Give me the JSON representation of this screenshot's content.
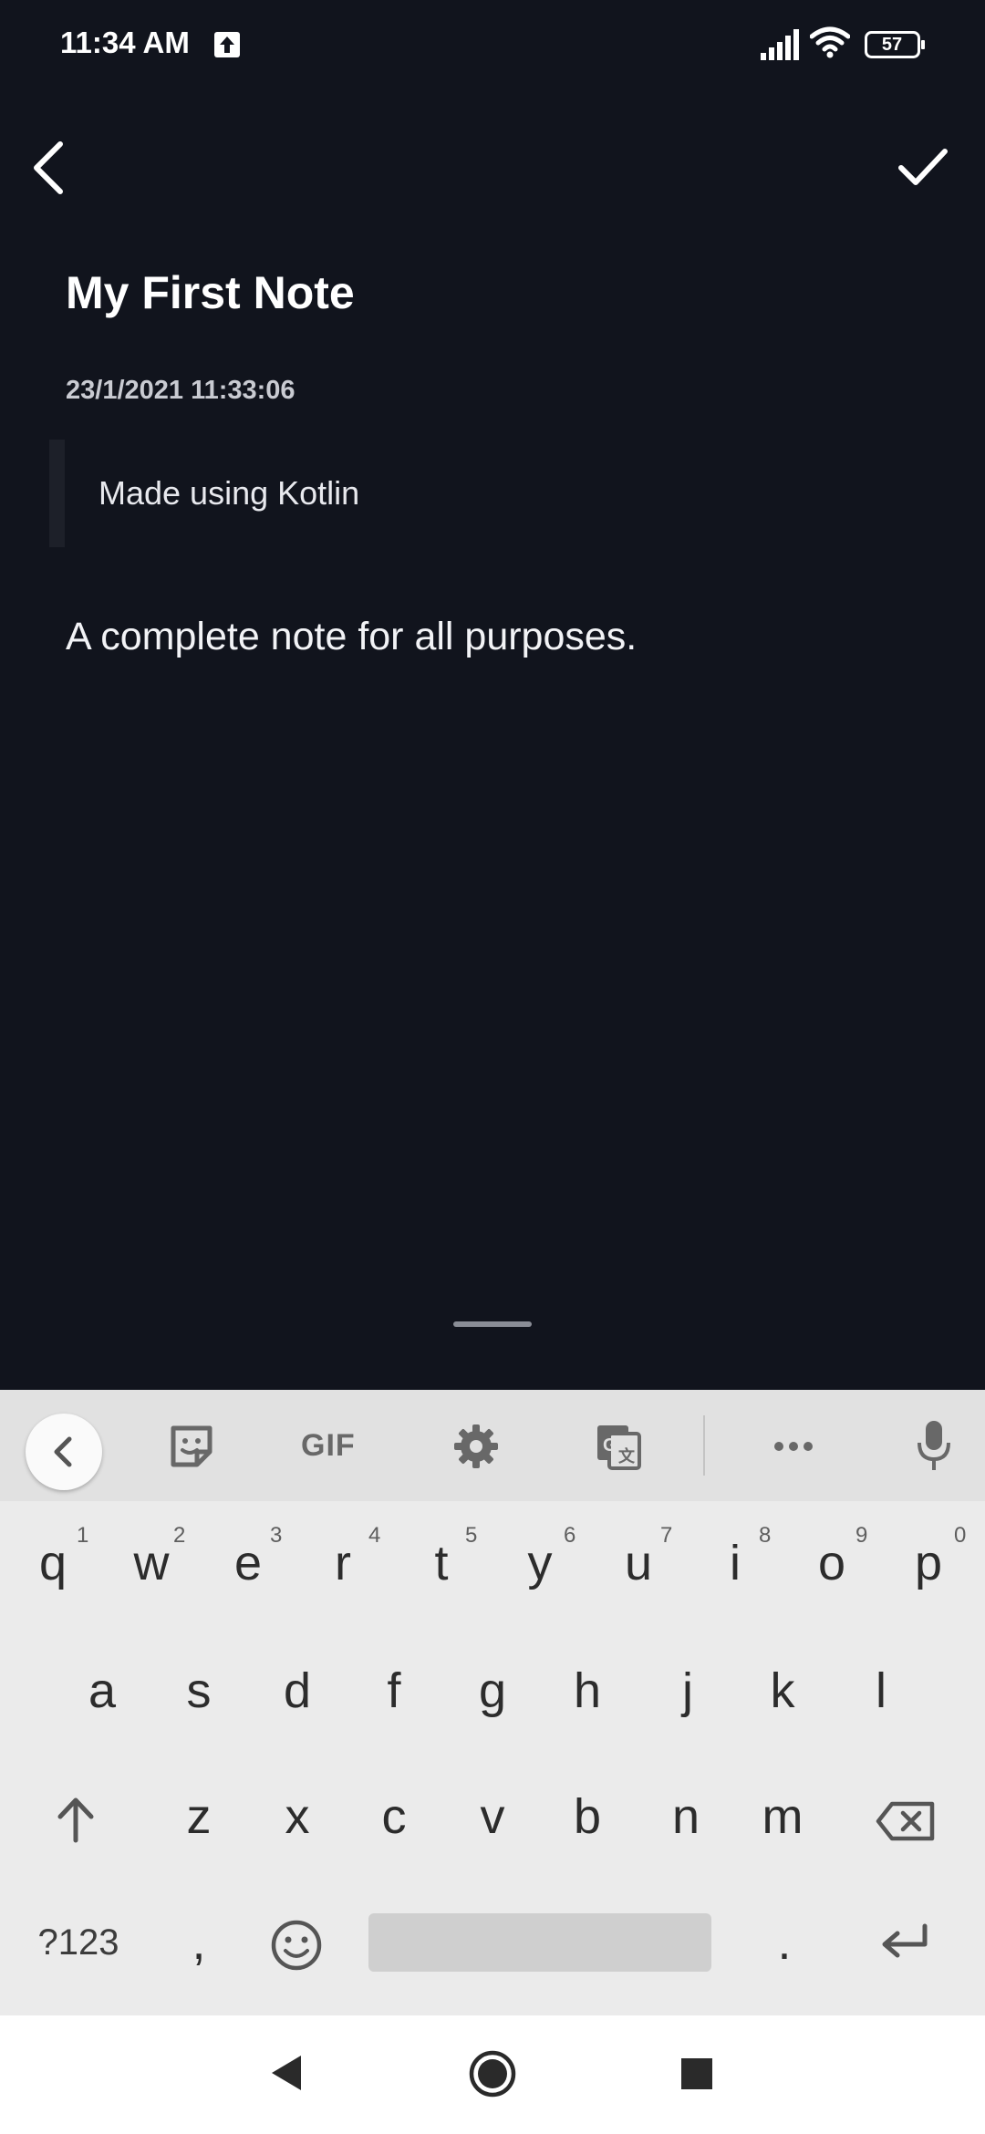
{
  "status_bar": {
    "time": "11:34 AM",
    "battery": "57",
    "icons": [
      "upload-icon",
      "signal-icon",
      "wifi-icon",
      "battery-icon"
    ]
  },
  "toolbar": {
    "back_icon": "chevron-left",
    "save_icon": "checkmark"
  },
  "note": {
    "title": "My First Note",
    "datetime": "23/1/2021 11:33:06",
    "subtitle": "Made using Kotlin",
    "body": "A complete note for all purposes."
  },
  "keyboard": {
    "toolbar": {
      "gif_label": "GIF",
      "icons": [
        "collapse-icon",
        "sticker-icon",
        "gif",
        "settings-icon",
        "translate-icon",
        "more-icon",
        "mic-icon"
      ]
    },
    "row1": [
      {
        "key": "q",
        "hint": "1"
      },
      {
        "key": "w",
        "hint": "2"
      },
      {
        "key": "e",
        "hint": "3"
      },
      {
        "key": "r",
        "hint": "4"
      },
      {
        "key": "t",
        "hint": "5"
      },
      {
        "key": "y",
        "hint": "6"
      },
      {
        "key": "u",
        "hint": "7"
      },
      {
        "key": "i",
        "hint": "8"
      },
      {
        "key": "o",
        "hint": "9"
      },
      {
        "key": "p",
        "hint": "0"
      }
    ],
    "row2": [
      "a",
      "s",
      "d",
      "f",
      "g",
      "h",
      "j",
      "k",
      "l"
    ],
    "row3": [
      "z",
      "x",
      "c",
      "v",
      "b",
      "n",
      "m"
    ],
    "row4": {
      "symbols": "?123",
      "comma": ",",
      "period": "."
    }
  },
  "nav_bar": {
    "icons": [
      "nav-back-icon",
      "nav-home-icon",
      "nav-recents-icon"
    ]
  },
  "colors": {
    "background": "#11141d",
    "keyboard": "#ebebeb",
    "keyboard_toolbar": "#e1e1e1"
  }
}
